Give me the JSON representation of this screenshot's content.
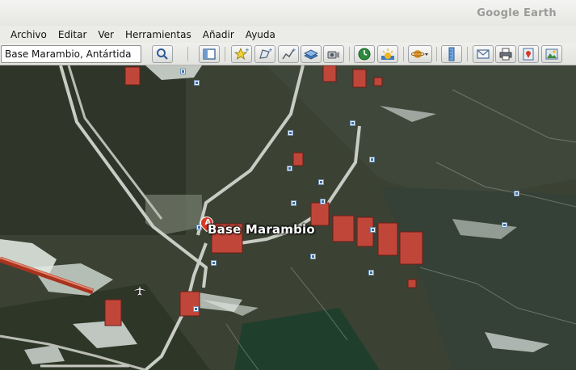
{
  "window": {
    "title": "Google Earth"
  },
  "menu": [
    {
      "label": "Archivo"
    },
    {
      "label": "Editar"
    },
    {
      "label": "Ver"
    },
    {
      "label": "Herramientas"
    },
    {
      "label": "Añadir"
    },
    {
      "label": "Ayuda"
    }
  ],
  "search": {
    "value": "Base Marambio, Antártida"
  },
  "toolbar": {
    "buttons": [
      "search-icon",
      "sidebar-toggle-icon",
      "add-placemark-icon",
      "add-polygon-icon",
      "add-path-icon",
      "add-image-overlay-icon",
      "record-tour-icon",
      "historical-imagery-icon",
      "sunlight-icon",
      "planets-icon",
      "ruler-icon",
      "email-icon",
      "print-icon",
      "view-in-maps-icon",
      "save-image-icon"
    ]
  },
  "map": {
    "place": {
      "marker_letter": "A",
      "label": "Base Marambio"
    }
  }
}
